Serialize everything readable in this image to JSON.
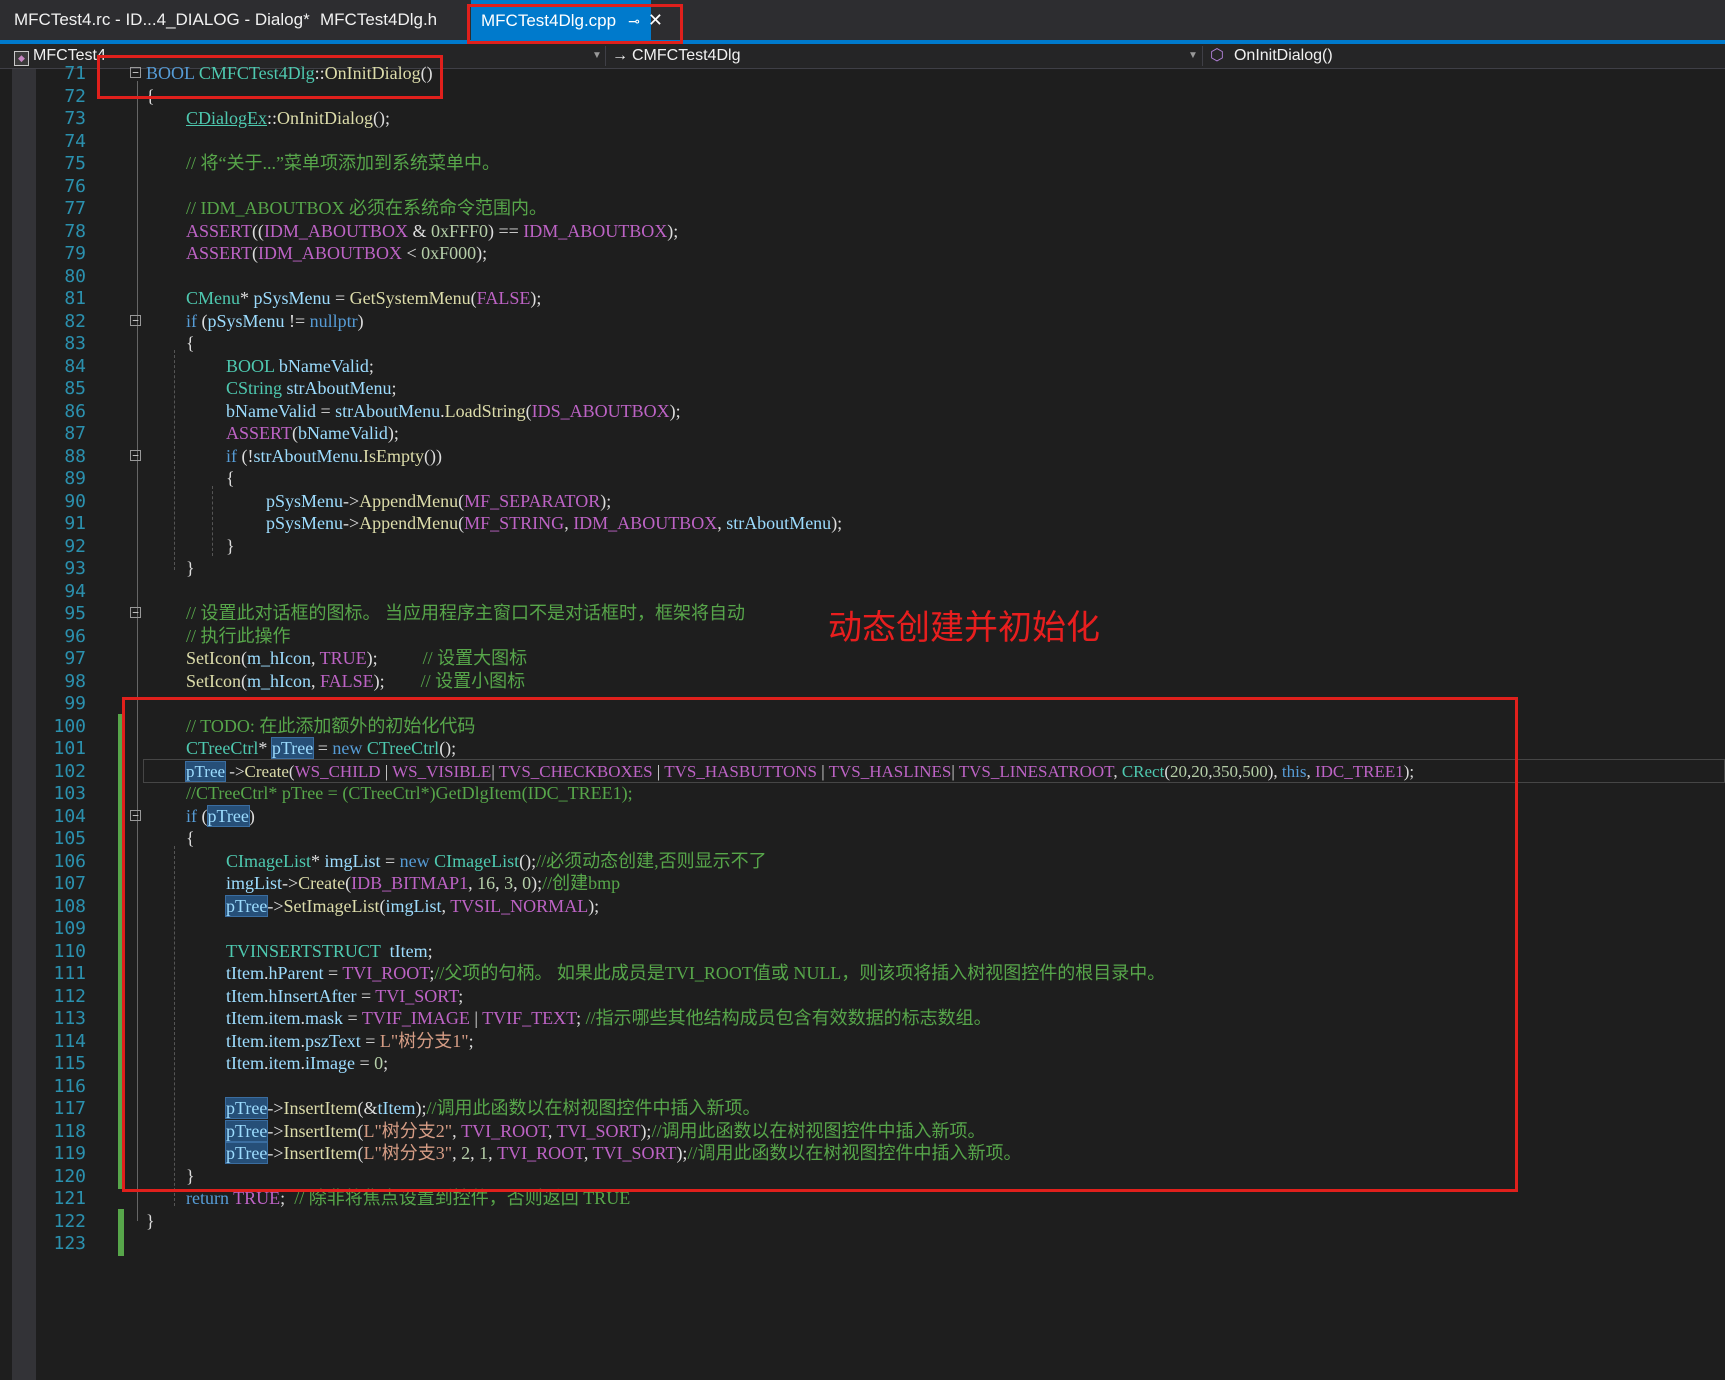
{
  "tabs": [
    {
      "label": "MFCTest4.rc - ID...4_DIALOG - Dialog*"
    },
    {
      "label": "MFCTest4Dlg.h"
    },
    {
      "label": "MFCTest4Dlg.cpp",
      "pin": "⊸",
      "close": "✕"
    }
  ],
  "nav": {
    "project": "MFCTest4",
    "class": "CMFCTest4Dlg",
    "member": "OnInitDialog()"
  },
  "annotation": "动态创建并初始化",
  "lines": [
    {
      "n": "71",
      "t": "BOOL CMFCTest4Dlg::OnInitDialog()"
    },
    {
      "n": "72",
      "t": "{"
    },
    {
      "n": "73",
      "t": "CDialogEx::OnInitDialog();"
    },
    {
      "n": "74",
      "t": ""
    },
    {
      "n": "75",
      "t": "// 将“关于...”菜单项添加到系统菜单中。"
    },
    {
      "n": "76",
      "t": ""
    },
    {
      "n": "77",
      "t": "// IDM_ABOUTBOX 必须在系统命令范围内。"
    },
    {
      "n": "78",
      "t": "ASSERT((IDM_ABOUTBOX & 0xFFF0) == IDM_ABOUTBOX);"
    },
    {
      "n": "79",
      "t": "ASSERT(IDM_ABOUTBOX < 0xF000);"
    },
    {
      "n": "80",
      "t": ""
    },
    {
      "n": "81",
      "t": "CMenu* pSysMenu = GetSystemMenu(FALSE);"
    },
    {
      "n": "82",
      "t": "if (pSysMenu != nullptr)"
    },
    {
      "n": "83",
      "t": "{"
    },
    {
      "n": "84",
      "t": "BOOL bNameValid;"
    },
    {
      "n": "85",
      "t": "CString strAboutMenu;"
    },
    {
      "n": "86",
      "t": "bNameValid = strAboutMenu.LoadString(IDS_ABOUTBOX);"
    },
    {
      "n": "87",
      "t": "ASSERT(bNameValid);"
    },
    {
      "n": "88",
      "t": "if (!strAboutMenu.IsEmpty())"
    },
    {
      "n": "89",
      "t": "{"
    },
    {
      "n": "90",
      "t": "pSysMenu->AppendMenu(MF_SEPARATOR);"
    },
    {
      "n": "91",
      "t": "pSysMenu->AppendMenu(MF_STRING, IDM_ABOUTBOX, strAboutMenu);"
    },
    {
      "n": "92",
      "t": "}"
    },
    {
      "n": "93",
      "t": "}"
    },
    {
      "n": "94",
      "t": ""
    },
    {
      "n": "95",
      "t": "// 设置此对话框的图标。 当应用程序主窗口不是对话框时，框架将自动"
    },
    {
      "n": "96",
      "t": "// 执行此操作"
    },
    {
      "n": "97",
      "t": "SetIcon(m_hIcon, TRUE);\t\t\t// 设置大图标"
    },
    {
      "n": "98",
      "t": "SetIcon(m_hIcon, FALSE);\t\t// 设置小图标"
    },
    {
      "n": "99",
      "t": ""
    },
    {
      "n": "100",
      "t": "// TODO: 在此添加额外的初始化代码"
    },
    {
      "n": "101",
      "t": "CTreeCtrl* pTree = new CTreeCtrl();"
    },
    {
      "n": "102",
      "t": "pTree ->Create(WS_CHILD | WS_VISIBLE| TVS_CHECKBOXES | TVS_HASBUTTONS | TVS_HASLINES| TVS_LINESATROOT, CRect(20,20,350,500), this, IDC_TREE1);"
    },
    {
      "n": "103",
      "t": "//CTreeCtrl* pTree = (CTreeCtrl*)GetDlgItem(IDC_TREE1);"
    },
    {
      "n": "104",
      "t": "if (pTree)"
    },
    {
      "n": "105",
      "t": "{"
    },
    {
      "n": "106",
      "t": "CImageList* imgList = new CImageList();//必须动态创建,否则显示不了"
    },
    {
      "n": "107",
      "t": "imgList->Create(IDB_BITMAP1, 16, 3, 0);//创建bmp"
    },
    {
      "n": "108",
      "t": "pTree->SetImageList(imgList, TVSIL_NORMAL);"
    },
    {
      "n": "109",
      "t": ""
    },
    {
      "n": "110",
      "t": "TVINSERTSTRUCT  tItem;"
    },
    {
      "n": "111",
      "t": "tItem.hParent = TVI_ROOT;//父项的句柄。 如果此成员是TVI_ROOT值或 NULL，则该项将插入树视图控件的根目录中。"
    },
    {
      "n": "112",
      "t": "tItem.hInsertAfter = TVI_SORT;"
    },
    {
      "n": "113",
      "t": "tItem.item.mask = TVIF_IMAGE | TVIF_TEXT; //指示哪些其他结构成员包含有效数据的标志数组。"
    },
    {
      "n": "114",
      "t": "tItem.item.pszText = L\"树分支1\";"
    },
    {
      "n": "115",
      "t": "tItem.item.iImage = 0;"
    },
    {
      "n": "116",
      "t": ""
    },
    {
      "n": "117",
      "t": "pTree->InsertItem(&tItem);//调用此函数以在树视图控件中插入新项。"
    },
    {
      "n": "118",
      "t": "pTree->InsertItem(L\"树分支2\", TVI_ROOT, TVI_SORT);//调用此函数以在树视图控件中插入新项。"
    },
    {
      "n": "119",
      "t": "pTree->InsertItem(L\"树分支3\", 2, 1, TVI_ROOT, TVI_SORT);//调用此函数以在树视图控件中插入新项。"
    },
    {
      "n": "120",
      "t": "}"
    },
    {
      "n": "121",
      "t": "return TRUE;  // 除非将焦点设置到控件，否则返回 TRUE"
    },
    {
      "n": "122",
      "t": "}"
    },
    {
      "n": "123",
      "t": ""
    }
  ],
  "colors": {
    "background": "#1e1e1e",
    "tab_active": "#007acc",
    "line_number": "#2b91af",
    "keyword": "#569cd6",
    "type": "#4ec9b0",
    "comment": "#57a64a",
    "function": "#dcdcaa",
    "macro": "#bd63c5",
    "annotation_red": "#e0201c"
  }
}
